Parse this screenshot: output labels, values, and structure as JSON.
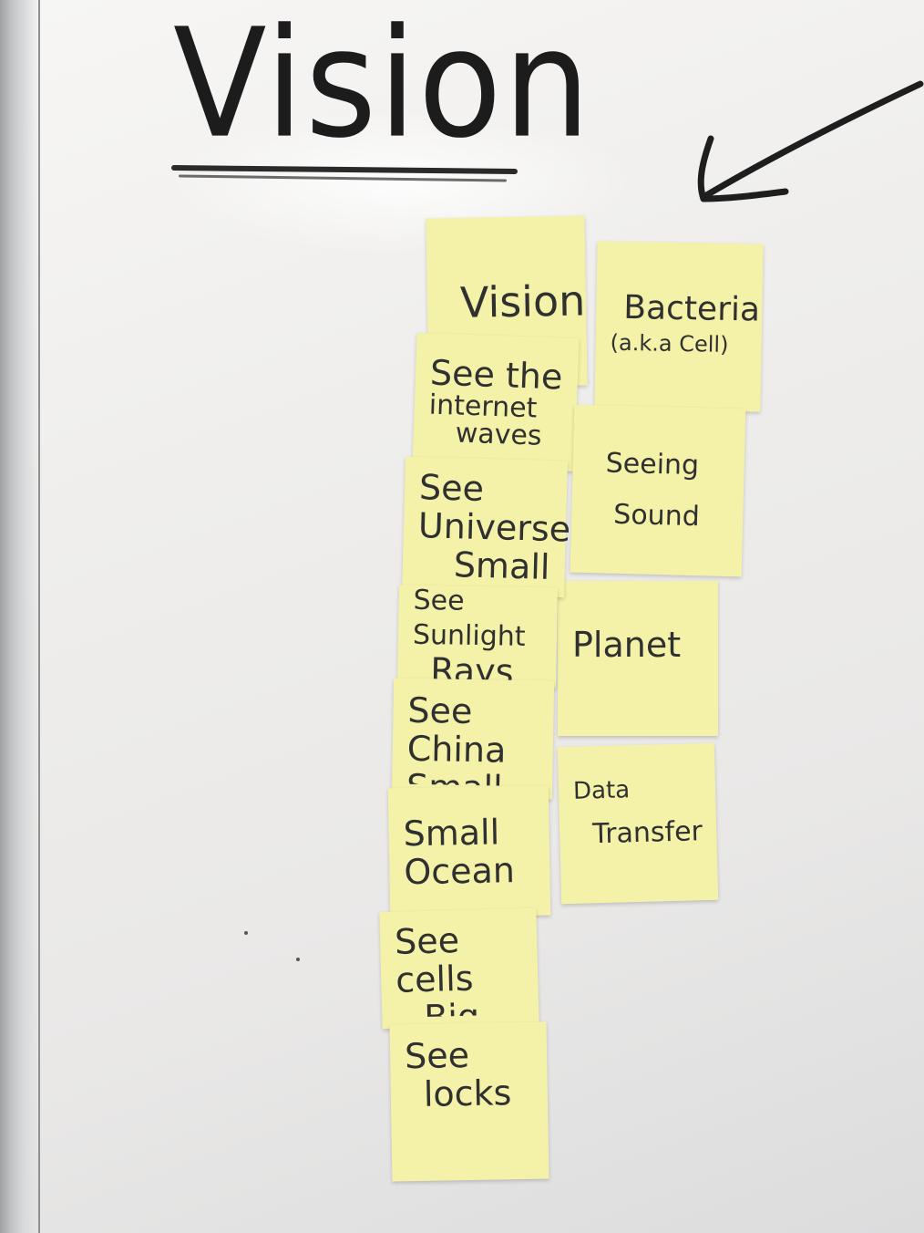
{
  "whiteboard": {
    "title": "Vision"
  },
  "notes_left": [
    {
      "lines": [
        "Vision"
      ]
    },
    {
      "lines": [
        "See the",
        "internet",
        "waves"
      ]
    },
    {
      "lines": [
        "See",
        "Universe",
        "Small"
      ]
    },
    {
      "lines": [
        "See Sunlight",
        "Rays"
      ]
    },
    {
      "lines": [
        "See",
        "China",
        "Small"
      ]
    },
    {
      "lines": [
        "Small",
        "Ocean"
      ]
    },
    {
      "lines": [
        "See",
        "cells",
        "Big"
      ]
    },
    {
      "lines": [
        "See",
        "locks"
      ]
    }
  ],
  "notes_right": [
    {
      "lines": [
        "Bacteria",
        "(a.k.a Cell)"
      ]
    },
    {
      "lines": [
        "Seeing",
        "Sound"
      ]
    },
    {
      "lines": [
        "Planet"
      ]
    },
    {
      "lines": [
        "Data",
        "Transfer"
      ]
    }
  ],
  "colors": {
    "sticky_note": "#f4f2a8",
    "marker_ink": "#1c1c1c",
    "whiteboard": "#efeeec"
  }
}
